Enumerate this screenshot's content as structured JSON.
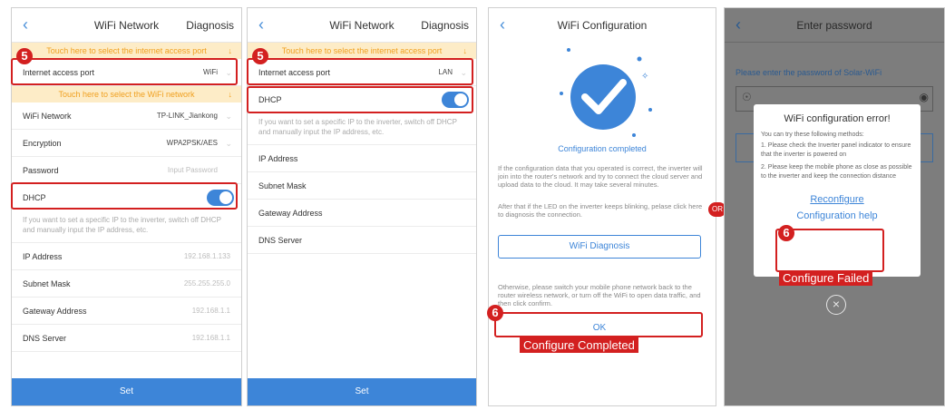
{
  "p1": {
    "back_icon": "chevron-left-icon",
    "title": "WiFi Network",
    "diagnosis": "Diagnosis",
    "banner1": "Touch here to select the internet access port",
    "access_label": "Internet access port",
    "access_value": "WiFi",
    "banner2": "Touch here to select the WiFi network",
    "wifi_label": "WiFi Network",
    "wifi_value": "TP-LINK_Jiankong",
    "enc_label": "Encryption",
    "enc_value": "WPA2PSK/AES",
    "pw_label": "Password",
    "pw_placeholder": "Input Password",
    "dhcp_label": "DHCP",
    "dhcp_hint": "If you want to set a specific IP to the inverter, switch off DHCP and manually input the IP address, etc.",
    "ip_label": "IP Address",
    "ip_value": "192.168.1.133",
    "mask_label": "Subnet Mask",
    "mask_value": "255.255.255.0",
    "gw_label": "Gateway Address",
    "gw_value": "192.168.1.1",
    "dns_label": "DNS Server",
    "dns_value": "192.168.1.1",
    "set": "Set",
    "step_num": "5"
  },
  "p2": {
    "title": "WiFi Network",
    "diagnosis": "Diagnosis",
    "banner1": "Touch here to select the internet access port",
    "access_label": "Internet access port",
    "access_value": "LAN",
    "dhcp_label": "DHCP",
    "dhcp_hint": "If you want to set a specific IP to the inverter, switch off DHCP and manually input the IP address, etc.",
    "ip_label": "IP Address",
    "mask_label": "Subnet Mask",
    "gw_label": "Gateway Address",
    "dns_label": "DNS Server",
    "set": "Set",
    "step_num": "5"
  },
  "p3": {
    "title": "WiFi Configuration",
    "status": "Configuration completed",
    "para1": "If the configuration data that you operated is correct, the inverter will join into the router's network and try to connect the cloud server and upload data to the cloud. It may take several minutes.",
    "para2": "After that if the LED on the inverter keeps blinking, pelase click here to diagnosis the connection.",
    "diag_button": "WiFi Diagnosis",
    "para3": "Otherwise, please switch your mobile phone network back to the router wireless network, or turn off the WiFi to open data traffic, and then click confirm.",
    "ok": "OK",
    "step_num": "6",
    "callout": "Configure Completed"
  },
  "p4": {
    "title": "Enter password",
    "prompt": "Please enter the password of Solar-WiFi",
    "dialog_title": "WiFi configuration error!",
    "dialog_intro": "You can try these following methods:",
    "method1": "1. Please check the Inverter panel indicator to ensure that the inverter is powered on",
    "method2": "2. Please keep the mobile phone as close as possible to the inverter and keep the connection distance",
    "reconfigure": "Reconfigure",
    "help": "Configuration help",
    "step_num": "6",
    "callout": "Configure Failed"
  },
  "or_label": "OR",
  "colors": {
    "accent": "#3d85d8",
    "highlight": "#d32020",
    "banner_bg": "#fdecc7",
    "banner_text": "#f0a020"
  }
}
